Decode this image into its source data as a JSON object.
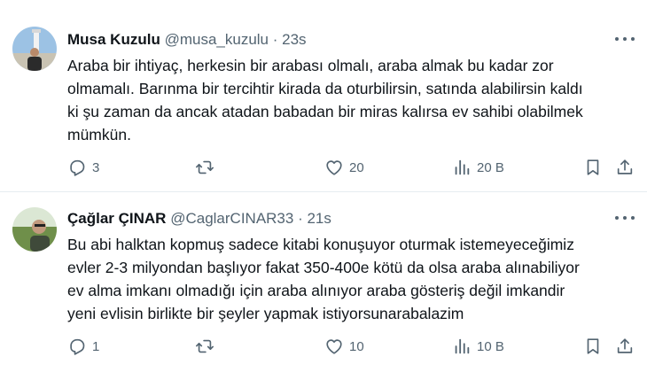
{
  "tweets": [
    {
      "name": "Musa Kuzulu",
      "handle": "@musa_kuzulu",
      "time": "· 23s",
      "lines": [
        "Araba bir ihtiyaç, herkesin bir arabası olmalı, araba almak bu kadar zor",
        "olmamalı. Barınma bir tercihtir kirada da oturbilirsin, satında alabilirsin kaldı",
        "ki şu zaman da ancak atadan babadan bir miras kalırsa ev sahibi olabilmek",
        "mümkün."
      ],
      "replies": "3",
      "retweets": "",
      "likes": "20",
      "views": "20 B"
    },
    {
      "name": "Çağlar ÇINAR",
      "handle": "@CaglarCINAR33",
      "time": "· 21s",
      "lines": [
        "Bu abi halktan kopmuş sadece kitabi konuşuyor oturmak istemeyeceğimiz",
        "evler 2-3 milyondan başlıyor fakat 350-400e kötü da olsa araba alınabiliyor",
        "ev alma imkanı olmadığı için araba alınıyor araba gösteriş değil imkandir",
        "yeni evlisin birlikte bir şeyler yapmak istiyorsunarabalazim"
      ],
      "replies": "1",
      "retweets": "",
      "likes": "10",
      "views": "10 B"
    }
  ],
  "icons": [
    "reply-icon",
    "retweet-icon",
    "like-icon",
    "views-icon",
    "bookmark-icon",
    "share-icon",
    "more-icon"
  ]
}
